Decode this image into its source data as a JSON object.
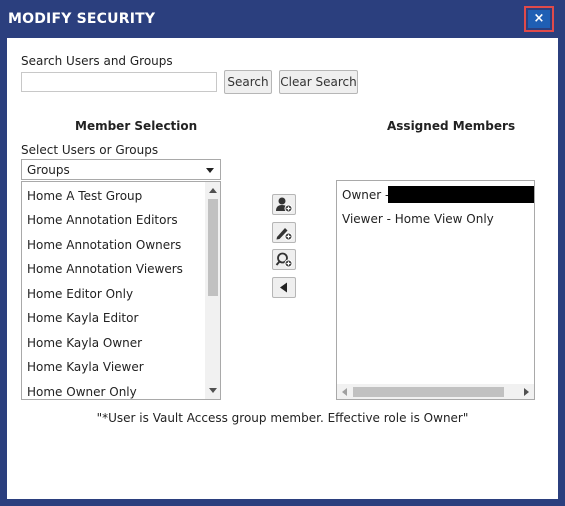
{
  "dialog": {
    "title": "MODIFY SECURITY",
    "close_label": "×",
    "accent_color": "#2b3f7e",
    "close_color": "#1f5fb4"
  },
  "search": {
    "label": "Search Users and Groups",
    "value": "",
    "placeholder": "",
    "search_button": "Search",
    "clear_button": "Clear Search"
  },
  "member_selection": {
    "heading": "Member Selection",
    "select_label": "Select Users or Groups",
    "selected_option": "Groups",
    "items": [
      "Home A Test Group",
      "Home Annotation Editors",
      "Home Annotation Owners",
      "Home Annotation Viewers",
      "Home Editor Only",
      "Home Kayla Editor",
      "Home Kayla Owner",
      "Home Kayla Viewer",
      "Home Owner Only"
    ]
  },
  "actions": {
    "icons": [
      "add-owner-icon",
      "add-editor-icon",
      "add-viewer-icon",
      "remove-arrow-icon"
    ]
  },
  "assigned_members": {
    "heading": "Assigned Members",
    "items": [
      {
        "label": "Owner - "
      },
      {
        "label": "Viewer - Home View Only"
      }
    ]
  },
  "footnote": "\"*User is Vault Access group member. Effective role is Owner\""
}
